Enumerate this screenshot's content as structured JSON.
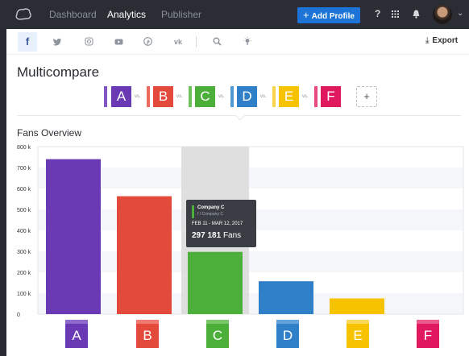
{
  "nav": {
    "items": [
      "Dashboard",
      "Analytics",
      "Publisher"
    ],
    "active": "Analytics",
    "add_profile_label": "Add Profile",
    "help_label": "?"
  },
  "networks": {
    "icons": [
      "facebook-icon",
      "twitter-icon",
      "instagram-icon",
      "youtube-icon",
      "pinterest-icon",
      "vk-icon",
      "search-icon",
      "insights-icon"
    ],
    "selected": "facebook-icon",
    "export_label": "Export"
  },
  "page": {
    "title": "Multicompare"
  },
  "compare": {
    "vs_label": "vs.",
    "add_label": "+",
    "profiles": [
      {
        "label": "A",
        "color": "#6a3ab5",
        "stripe": "#7f56c4"
      },
      {
        "label": "B",
        "color": "#e44a3b",
        "stripe": "#ea6a5d"
      },
      {
        "label": "C",
        "color": "#4caf3a",
        "stripe": "#6cc15c"
      },
      {
        "label": "D",
        "color": "#2f80c8",
        "stripe": "#5299d4"
      },
      {
        "label": "E",
        "color": "#f7c300",
        "stripe": "#f9d34c"
      },
      {
        "label": "F",
        "color": "#e0195f",
        "stripe": "#e84a81"
      }
    ]
  },
  "section": {
    "title": "Fans Overview"
  },
  "chart_data": {
    "type": "bar",
    "categories": [
      "A",
      "B",
      "C",
      "D",
      "E",
      "F"
    ],
    "values": [
      740000,
      563000,
      297181,
      157000,
      75000,
      0
    ],
    "colors": [
      "#6a3ab5",
      "#e44a3b",
      "#4caf3a",
      "#2f80c8",
      "#f7c300",
      "#e0195f"
    ],
    "ylim": [
      0,
      800000
    ],
    "yticks": [
      "0",
      "100 k",
      "200 k",
      "300 k",
      "400 k",
      "500 k",
      "600 k",
      "700 k",
      "800 k"
    ],
    "highlighted_category": "C"
  },
  "tooltip": {
    "name": "Company C",
    "sub": "f  / Company C",
    "date": "FEB 11 - MAR 12, 2017",
    "value": "297 181",
    "unit": "Fans"
  }
}
